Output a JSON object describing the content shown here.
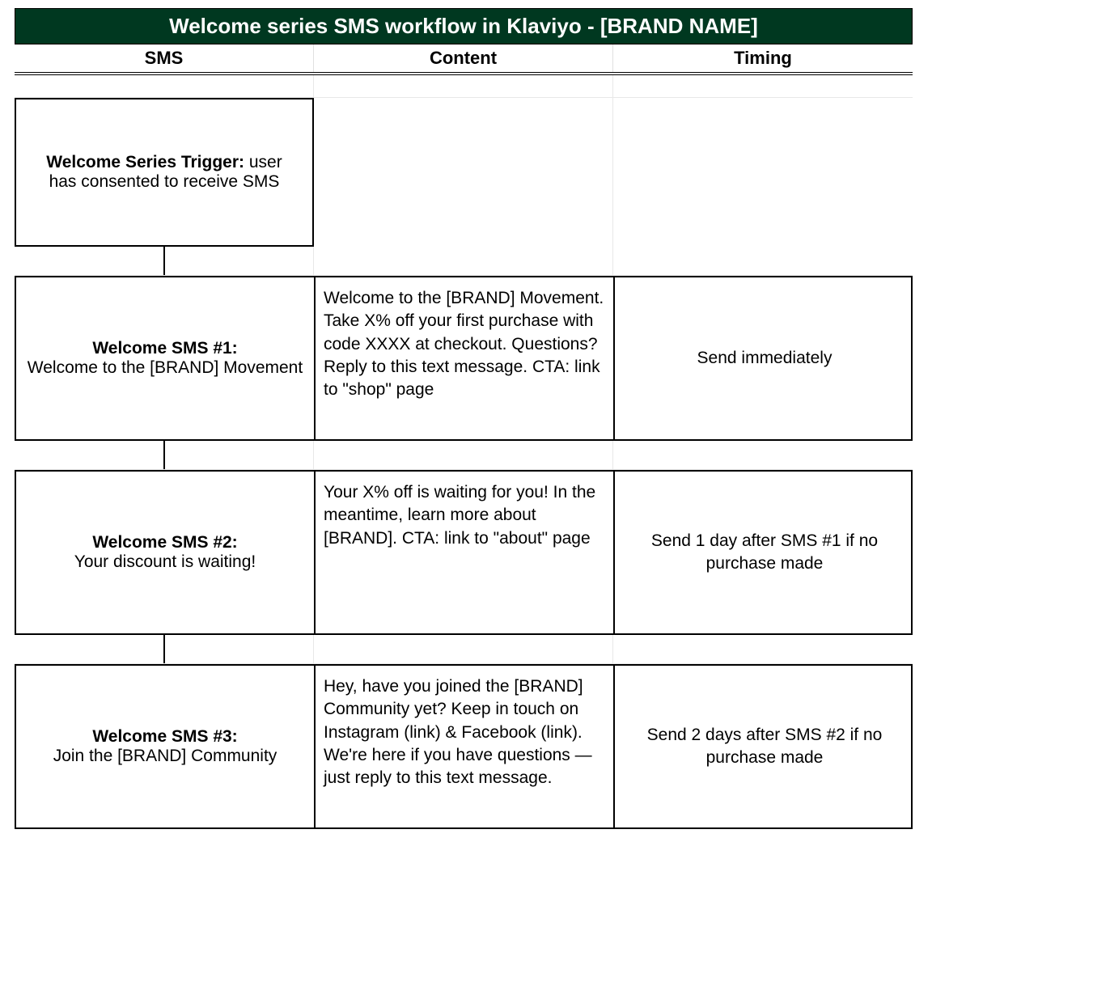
{
  "title": "Welcome series SMS workflow in Klaviyo - [BRAND NAME]",
  "headers": {
    "col1": "SMS",
    "col2": "Content",
    "col3": "Timing"
  },
  "trigger": {
    "label_bold": "Welcome Series Trigger:",
    "label_rest": " user has consented to receive SMS"
  },
  "steps": [
    {
      "label_bold": "Welcome SMS #1:",
      "label_rest": "Welcome to the [BRAND] Movement",
      "content": "Welcome to the [BRAND] Movement. Take X% off your first purchase with code XXXX at checkout. Questions? Reply to this text message. CTA: link to \"shop\" page",
      "timing": "Send immediately"
    },
    {
      "label_bold": "Welcome SMS #2:",
      "label_rest": "Your discount is waiting!",
      "content": "Your X% off is waiting for you! In the meantime, learn more about [BRAND]. CTA: link to \"about\" page",
      "timing": "Send 1 day after SMS #1 if no purchase made"
    },
    {
      "label_bold": "Welcome SMS #3:",
      "label_rest": "Join the [BRAND] Community",
      "content": "Hey, have you joined the [BRAND] Community yet? Keep in touch on Instagram (link) & Facebook (link). We're here if you have questions — just reply to this text message.",
      "timing": "Send 2 days after SMS #2 if no purchase made"
    }
  ]
}
